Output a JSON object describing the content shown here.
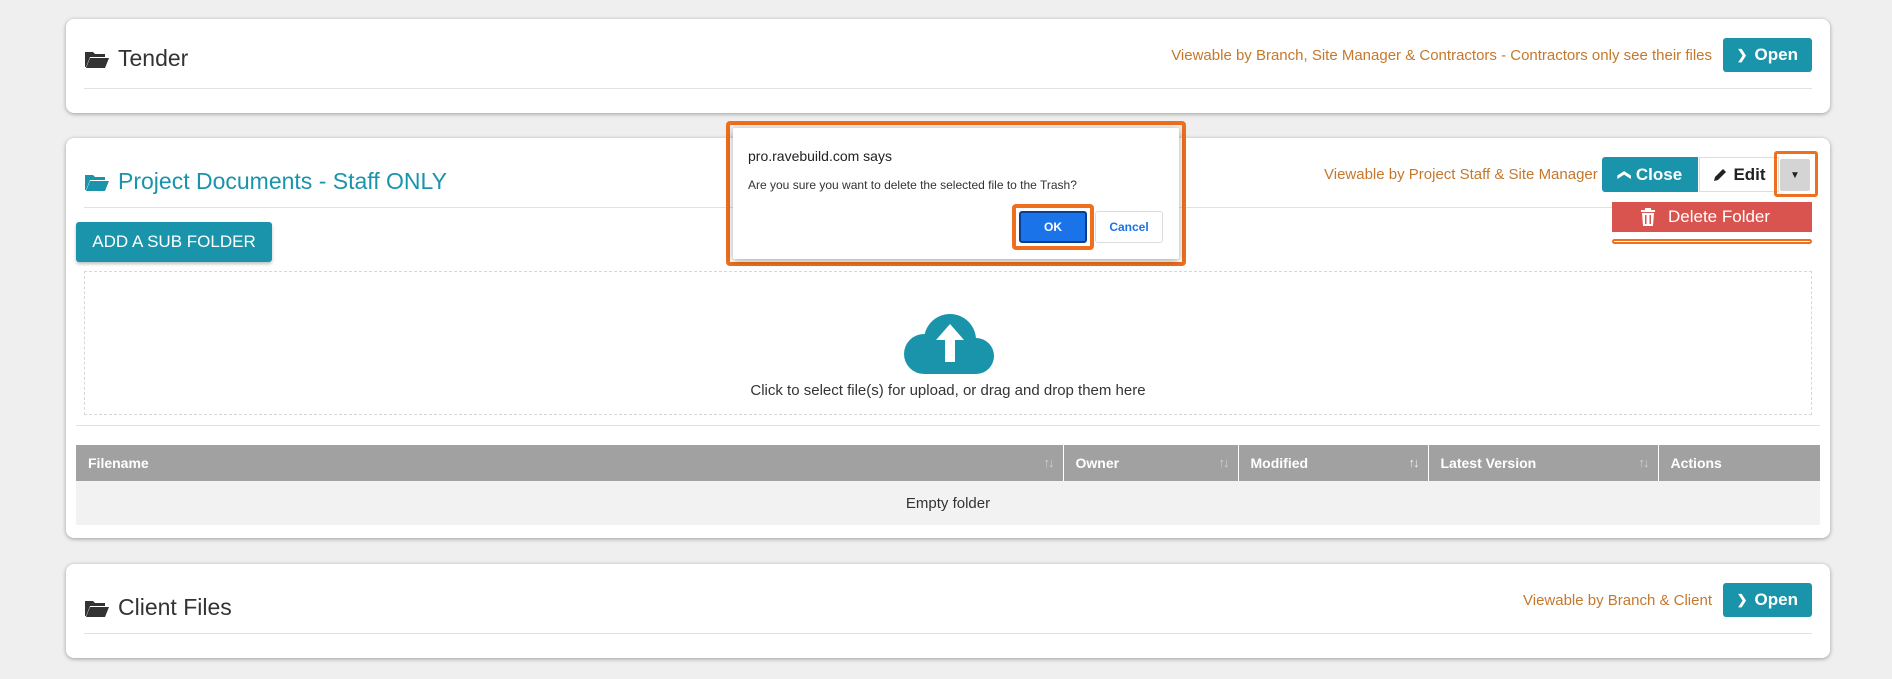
{
  "panels": {
    "tender": {
      "title": "Tender",
      "viewable": "Viewable by Branch, Site Manager & Contractors - Contractors only see their files",
      "open_label": "Open"
    },
    "project_docs": {
      "title": "Project Documents - Staff ONLY",
      "viewable": "Viewable by Project Staff & Site Manager",
      "close_label": "Close",
      "edit_label": "Edit",
      "delete_folder_label": "Delete Folder",
      "add_sub_folder_label": "ADD A SUB FOLDER",
      "upload_text": "Click to select file(s) for upload, or drag and drop them here",
      "table": {
        "columns": [
          "Filename",
          "Owner",
          "Modified",
          "Latest Version",
          "Actions"
        ],
        "empty_text": "Empty folder"
      }
    },
    "client_files": {
      "title": "Client Files",
      "viewable": "Viewable by Branch & Client",
      "open_label": "Open"
    }
  },
  "dialog": {
    "title": "pro.ravebuild.com says",
    "message": "Are you sure you want to delete the selected file to the Trash?",
    "ok_label": "OK",
    "cancel_label": "Cancel"
  },
  "colors": {
    "accent": "#1a94aa",
    "viewable_text": "#c5782c",
    "danger": "#d9534f",
    "highlight": "#ee6f1d",
    "dialog_primary": "#1a73e8"
  }
}
